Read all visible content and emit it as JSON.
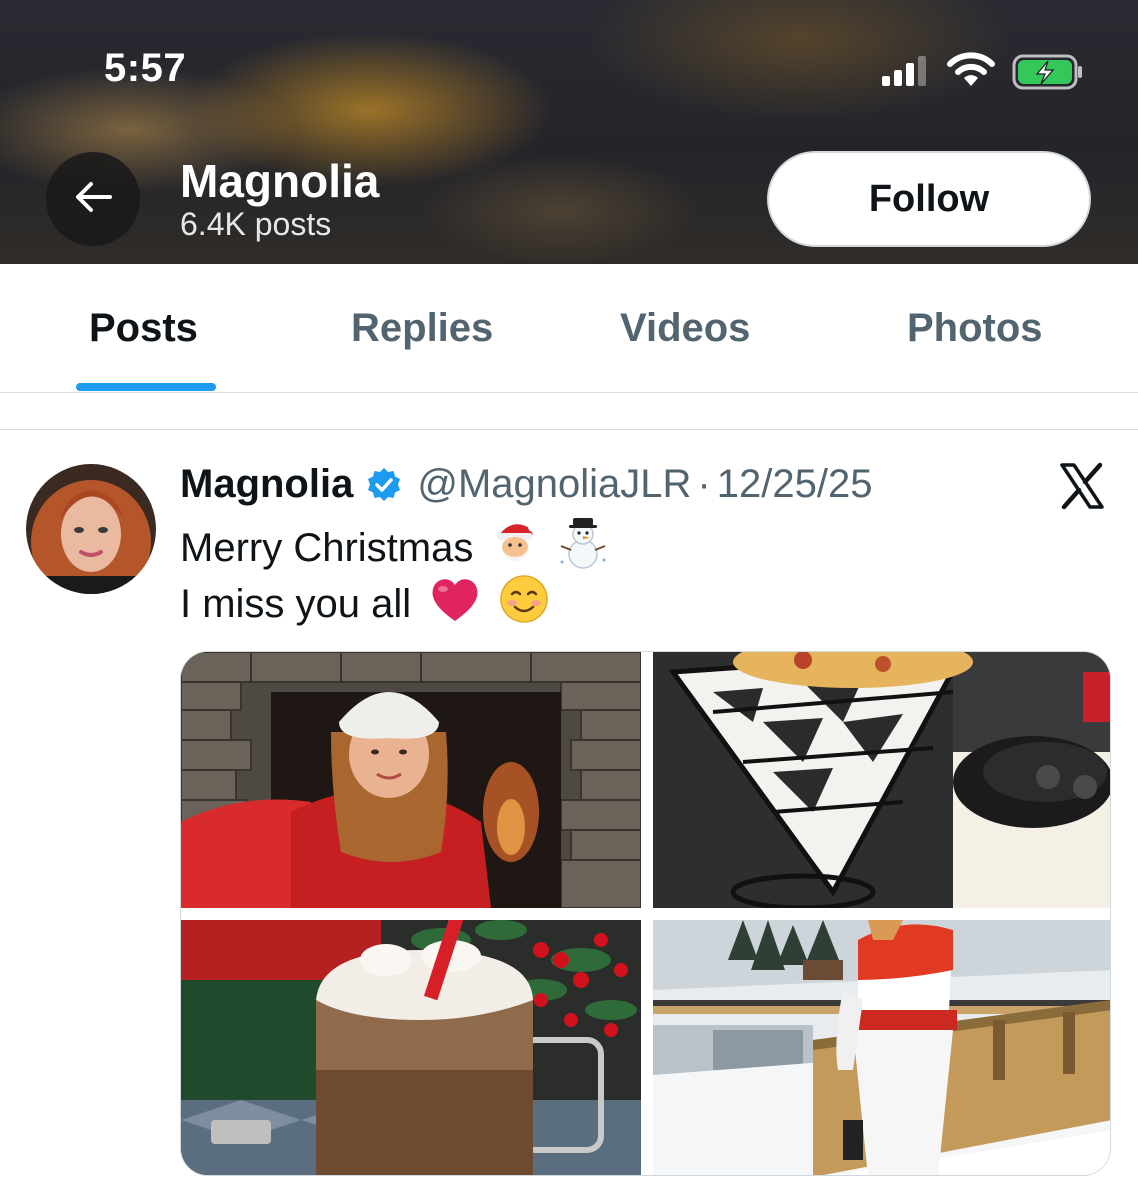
{
  "status_bar": {
    "time": "5:57",
    "signal_icon": "cellular-signal-icon",
    "wifi_icon": "wifi-icon",
    "battery_icon": "battery-charging-icon"
  },
  "header": {
    "back_icon": "arrow-left-icon",
    "name": "Magnolia",
    "posts_count": "6.4K posts",
    "follow_label": "Follow"
  },
  "tabs": [
    {
      "label": "Posts",
      "active": true
    },
    {
      "label": "Replies",
      "active": false
    },
    {
      "label": "Videos",
      "active": false
    },
    {
      "label": "Photos",
      "active": false
    }
  ],
  "post": {
    "author_name": "Magnolia",
    "verified_icon": "verified-badge-icon",
    "handle": "@MagnoliaJLR",
    "separator": "·",
    "date": "12/25/25",
    "platform_icon": "x-logo-icon",
    "line1": "Merry Christmas",
    "line2": "I miss you all",
    "line1_emojis": [
      "santa-emoji",
      "snowman-emoji"
    ],
    "line2_emojis": [
      "red-heart-emoji",
      "smiling-face-emoji"
    ]
  },
  "colors": {
    "accent": "#1d9bf0",
    "text_primary": "#0f1419",
    "text_secondary": "#536471",
    "heart": "#e0245e"
  }
}
